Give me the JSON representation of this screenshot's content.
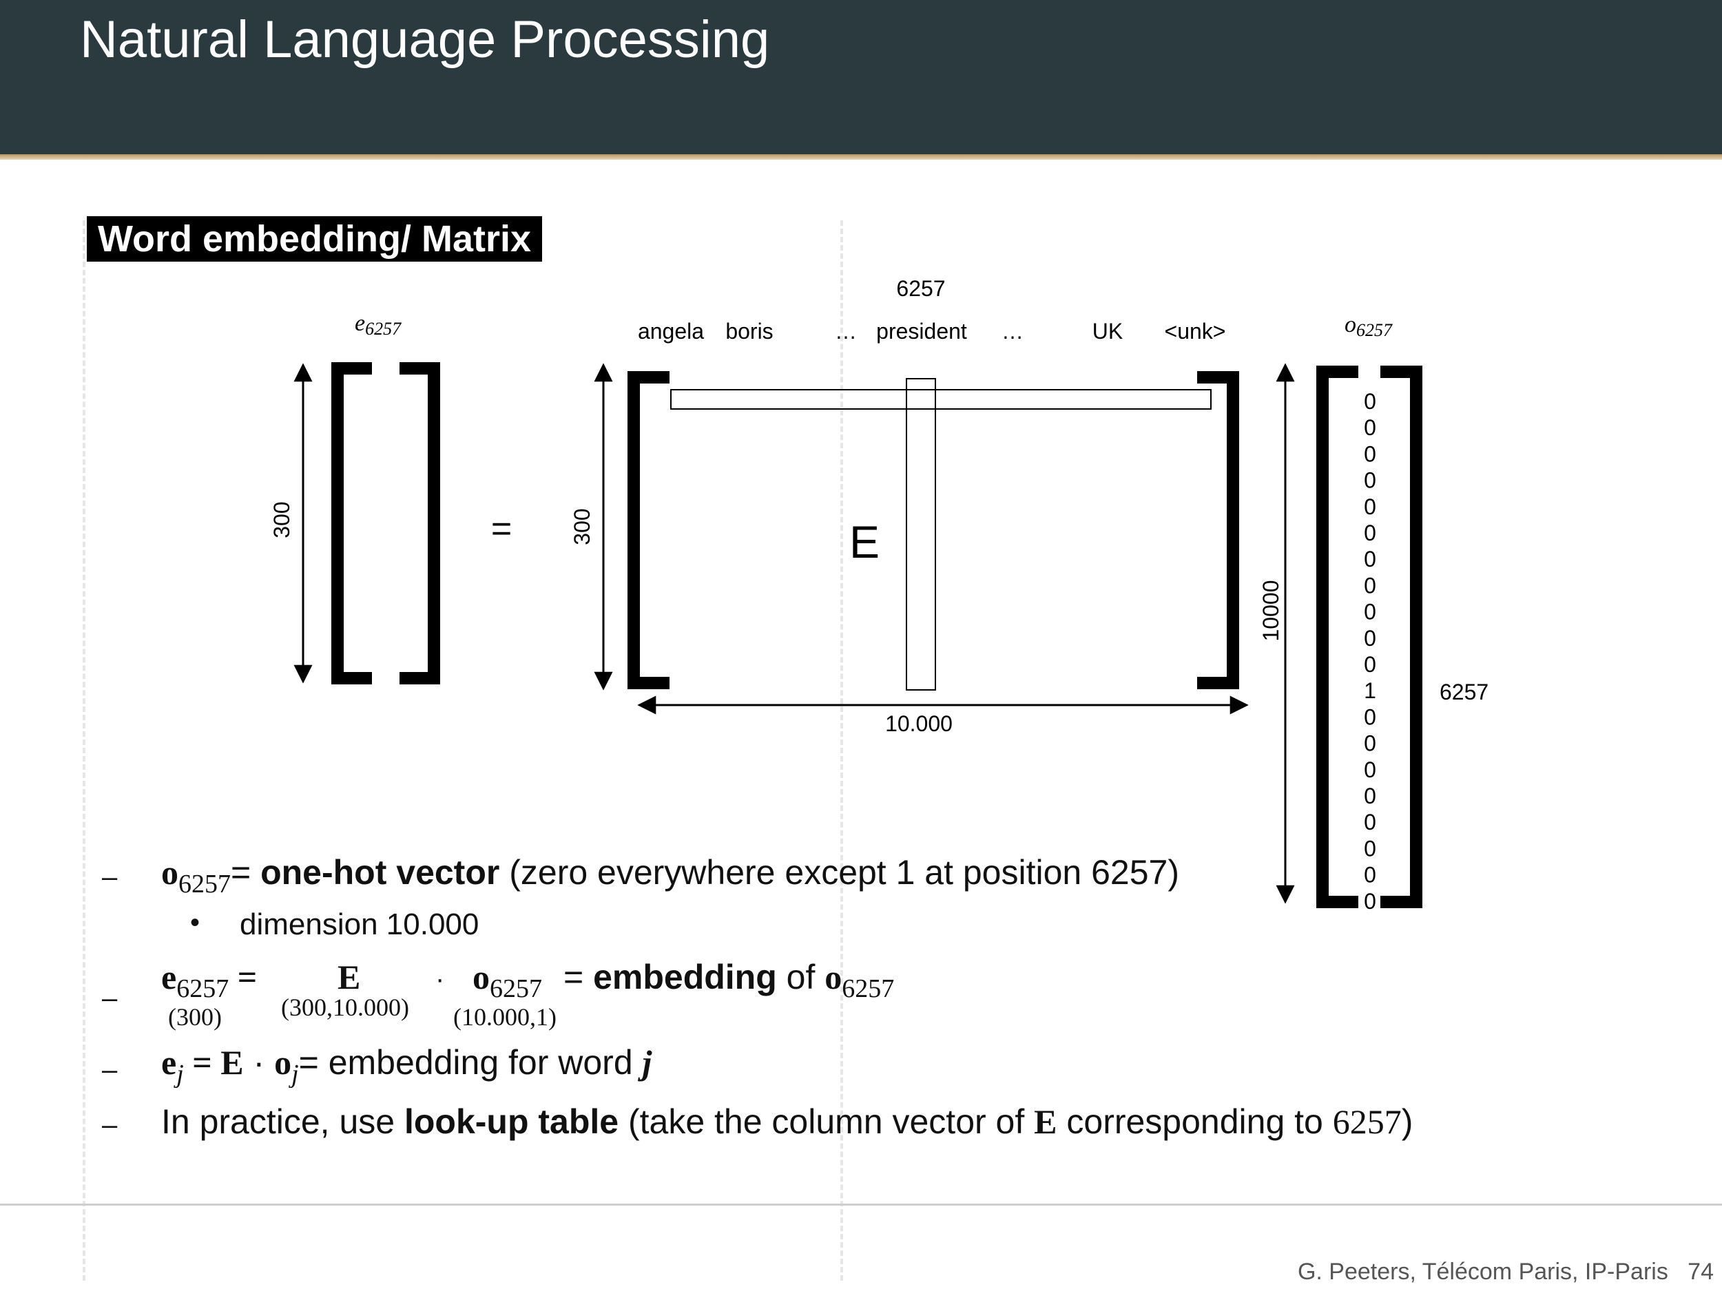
{
  "header": {
    "title": "Natural Language Processing"
  },
  "section": {
    "title": "Word embedding/ Matrix"
  },
  "diagram": {
    "e_label": "e",
    "e_sub": "6257",
    "e_height": "300",
    "equals": "=",
    "E_height": "300",
    "E_label": "E",
    "E_width": "10.000",
    "column_index": "6257",
    "vocab": [
      "angela",
      "boris",
      "…",
      "president",
      "…",
      "UK",
      "<unk>"
    ],
    "o_label": "o",
    "o_sub": "6257",
    "o_height": "10000",
    "o_position": "6257",
    "one_hot": [
      "0",
      "0",
      "0",
      "0",
      "0",
      "0",
      "0",
      "0",
      "0",
      "0",
      "0",
      "1",
      "0",
      "0",
      "0",
      "0",
      "0",
      "0",
      "0",
      "0"
    ]
  },
  "bullets": {
    "b1": {
      "sym": "o",
      "sub": "6257",
      "eq": "= ",
      "bold": "one-hot vector",
      "rest": " (zero everywhere except 1 at position 6257)"
    },
    "b1_sub": "dimension 10.000",
    "b2": {
      "e": "e",
      "e_sub": "6257",
      "eq": " = ",
      "e_dim": "(300)",
      "E": "E",
      "E_dim": "(300,10.000)",
      "dot": "·",
      "o": "o",
      "o_sub": "6257",
      "o_dim": "(10.000,1)",
      "eq2": " = ",
      "bold": "embedding",
      "of": " of ",
      "o2": "o",
      "o2_sub": "6257"
    },
    "b3": {
      "e": "e",
      "e_sub": "j",
      "eq": " = ",
      "E": "E",
      "dot": " · ",
      "o": "o",
      "o_sub": "j",
      "rest": "= embedding for word ",
      "j": "j"
    },
    "b4": {
      "pre": "In practice, use ",
      "bold": "look-up table",
      "mid": " (take the column vector of ",
      "E": "E",
      "mid2": " corresponding to ",
      "num": "6257",
      "end": ")"
    }
  },
  "footer": {
    "author": "G. Peeters, Télécom Paris, IP-Paris",
    "page": "74"
  }
}
